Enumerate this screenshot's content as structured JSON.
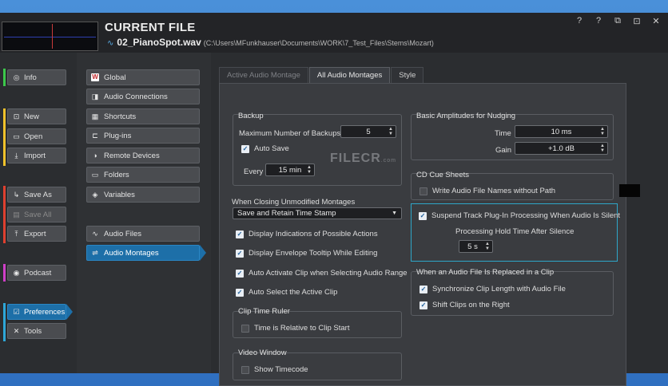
{
  "header": {
    "section_title": "CURRENT FILE",
    "file_name": "02_PianoSpot.wav",
    "file_path": "(C:\\Users\\MFunkhauser\\Documents\\WORK\\7_Test_Files\\Stems\\Mozart)",
    "icons": [
      "help-cursor-icon",
      "help-icon",
      "restore-windows-icon",
      "window-layout-icon",
      "close-icon"
    ],
    "icon_glyphs": [
      "?",
      "?",
      "⧉",
      "⊡",
      "✕"
    ]
  },
  "sidebar": {
    "info": "Info",
    "new": "New",
    "open": "Open",
    "import": "Import",
    "save_as": "Save As",
    "save_all": "Save All",
    "export": "Export",
    "podcast": "Podcast",
    "preferences": "Preferences",
    "tools": "Tools",
    "bar_colors": {
      "info": "#3cc84a",
      "file": "#f0c22a",
      "save": "#e0402f",
      "podcast": "#d03fc8",
      "prefs": "#2ea7d8"
    }
  },
  "categories": {
    "global": "Global",
    "audio_connections": "Audio Connections",
    "shortcuts": "Shortcuts",
    "plugins": "Plug-ins",
    "remote_devices": "Remote Devices",
    "folders": "Folders",
    "variables": "Variables",
    "audio_files": "Audio Files",
    "audio_montages": "Audio Montages"
  },
  "tabs": {
    "active_audio_montage": "Active Audio Montage",
    "all_audio_montages": "All Audio Montages",
    "style": "Style"
  },
  "backup": {
    "title": "Backup",
    "max_label": "Maximum Number of Backups",
    "max_value": "5",
    "auto_save": "Auto Save",
    "every_label": "Every",
    "every_value": "15 min"
  },
  "closing": {
    "title": "When Closing Unmodified Montages",
    "selected": "Save and Retain Time Stamp",
    "opt1": "Display Indications of Possible Actions",
    "opt2": "Display Envelope Tooltip While Editing",
    "opt3": "Auto Activate Clip when Selecting Audio Range",
    "opt4": "Auto Select the Active Clip"
  },
  "clip_time_ruler": {
    "title": "Clip Time Ruler",
    "opt": "Time is Relative to Clip Start"
  },
  "video_window": {
    "title": "Video Window",
    "opt": "Show Timecode"
  },
  "nudging": {
    "title": "Basic Amplitudes for Nudging",
    "time_label": "Time",
    "time_value": "10 ms",
    "gain_label": "Gain",
    "gain_value": "+1.0 dB"
  },
  "cue_sheets": {
    "title": "CD Cue Sheets",
    "opt": "Write Audio File Names without Path"
  },
  "suspend": {
    "opt": "Suspend Track Plug-In Processing When Audio Is Silent",
    "hold_label": "Processing Hold Time After Silence",
    "hold_value": "5 s"
  },
  "replaced": {
    "title": "When an Audio File Is Replaced in a Clip",
    "opt1": "Synchronize Clip Length with Audio File",
    "opt2": "Shift Clips on the Right"
  },
  "watermark": {
    "main": "FILECR",
    "sub": ".com"
  }
}
